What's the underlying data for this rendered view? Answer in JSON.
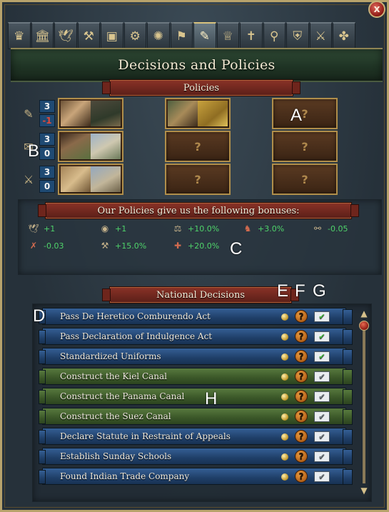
{
  "window": {
    "title": "Decisions and Policies",
    "close_glyph": "x",
    "tabs": [
      {
        "icon": "crown-icon",
        "glyph": "♛",
        "active": false
      },
      {
        "icon": "temple-icon",
        "glyph": "🏛",
        "active": false
      },
      {
        "icon": "dove-icon",
        "glyph": "🕊",
        "active": false
      },
      {
        "icon": "trade-goods-icon",
        "glyph": "⚒",
        "active": false
      },
      {
        "icon": "crate-icon",
        "glyph": "▣",
        "active": false
      },
      {
        "icon": "gears-icon",
        "glyph": "⚙",
        "active": false
      },
      {
        "icon": "lightbulb-icon",
        "glyph": "✺",
        "active": false
      },
      {
        "icon": "flag-icon",
        "glyph": "⚑",
        "active": false
      },
      {
        "icon": "decisions-scroll-icon",
        "glyph": "✎",
        "active": true
      },
      {
        "icon": "estates-crown-icon",
        "glyph": "♕",
        "active": false
      },
      {
        "icon": "religion-cross-icon",
        "glyph": "✝",
        "active": false
      },
      {
        "icon": "magnifier-icon",
        "glyph": "⚲",
        "active": false
      },
      {
        "icon": "shield-icon",
        "glyph": "⛨",
        "active": false
      },
      {
        "icon": "sword-icon",
        "glyph": "⚔",
        "active": false
      },
      {
        "icon": "extra-tab-icon",
        "glyph": "✤",
        "active": false
      }
    ]
  },
  "policies": {
    "header": "Policies",
    "rows": [
      {
        "category": "administrative",
        "icon": "admin-icon",
        "glyph": "✎",
        "available": "3",
        "used": "-1",
        "used_negative": true
      },
      {
        "category": "diplomatic",
        "icon": "diplomatic-icon",
        "glyph": "✉",
        "available": "3",
        "used": "0",
        "used_negative": false
      },
      {
        "category": "military",
        "icon": "military-icon",
        "glyph": "⚔",
        "available": "3",
        "used": "0",
        "used_negative": false
      }
    ],
    "empty_slot_glyph": "?"
  },
  "bonuses": {
    "header": "Our Policies give us the following bonuses:",
    "items": [
      {
        "icon": "dove-bonus-icon",
        "glyph": "🕊",
        "value": "+1",
        "tone": "normal"
      },
      {
        "icon": "advisor-bonus-icon",
        "glyph": "◉",
        "value": "+1",
        "tone": "normal"
      },
      {
        "icon": "trade-bonus-icon",
        "glyph": "⚖",
        "value": "+10.0%",
        "tone": "normal"
      },
      {
        "icon": "manpower-bonus-icon",
        "glyph": "♞",
        "value": "+3.0%",
        "tone": "red"
      },
      {
        "icon": "cannon-bonus-icon",
        "glyph": "⚯",
        "value": "-0.05",
        "tone": "normal"
      },
      {
        "icon": "unrest-bonus-icon",
        "glyph": "✗",
        "value": "-0.03",
        "tone": "red"
      },
      {
        "icon": "build-bonus-icon",
        "glyph": "⚒",
        "value": "+15.0%",
        "tone": "normal"
      },
      {
        "icon": "morale-bonus-icon",
        "glyph": "✚",
        "value": "+20.0%",
        "tone": "red"
      }
    ]
  },
  "decisions": {
    "header": "National Decisions",
    "items": [
      {
        "label": "Pass De Heretico Comburendo Act",
        "style": "blue",
        "enactable": true
      },
      {
        "label": "Pass Declaration of Indulgence Act",
        "style": "blue",
        "enactable": true
      },
      {
        "label": "Standardized Uniforms",
        "style": "blue",
        "enactable": true
      },
      {
        "label": "Construct the Kiel Canal",
        "style": "green",
        "enactable": false
      },
      {
        "label": "Construct the Panama Canal",
        "style": "green",
        "enactable": false
      },
      {
        "label": "Construct the Suez Canal",
        "style": "green",
        "enactable": false
      },
      {
        "label": "Declare Statute in Restraint of Appeals",
        "style": "blue",
        "enactable": false
      },
      {
        "label": "Establish Sunday Schools",
        "style": "blue",
        "enactable": false
      },
      {
        "label": "Found Indian Trade Company",
        "style": "blue",
        "enactable": false
      }
    ],
    "help_glyph": "?",
    "envelope_check_glyph": "✔"
  },
  "scrollbar": {
    "up_glyph": "▲",
    "down_glyph": "▼"
  },
  "annotations": {
    "A": "A",
    "B": "B",
    "C": "C",
    "D": "D",
    "E": "E",
    "F": "F",
    "G": "G",
    "H": "H"
  },
  "colors": {
    "positive": "#4fd36a",
    "negative": "#e04a3a",
    "decision_blue": "#1f3f68",
    "decision_green": "#3a5628",
    "ribbon_red": "#8a3227"
  }
}
